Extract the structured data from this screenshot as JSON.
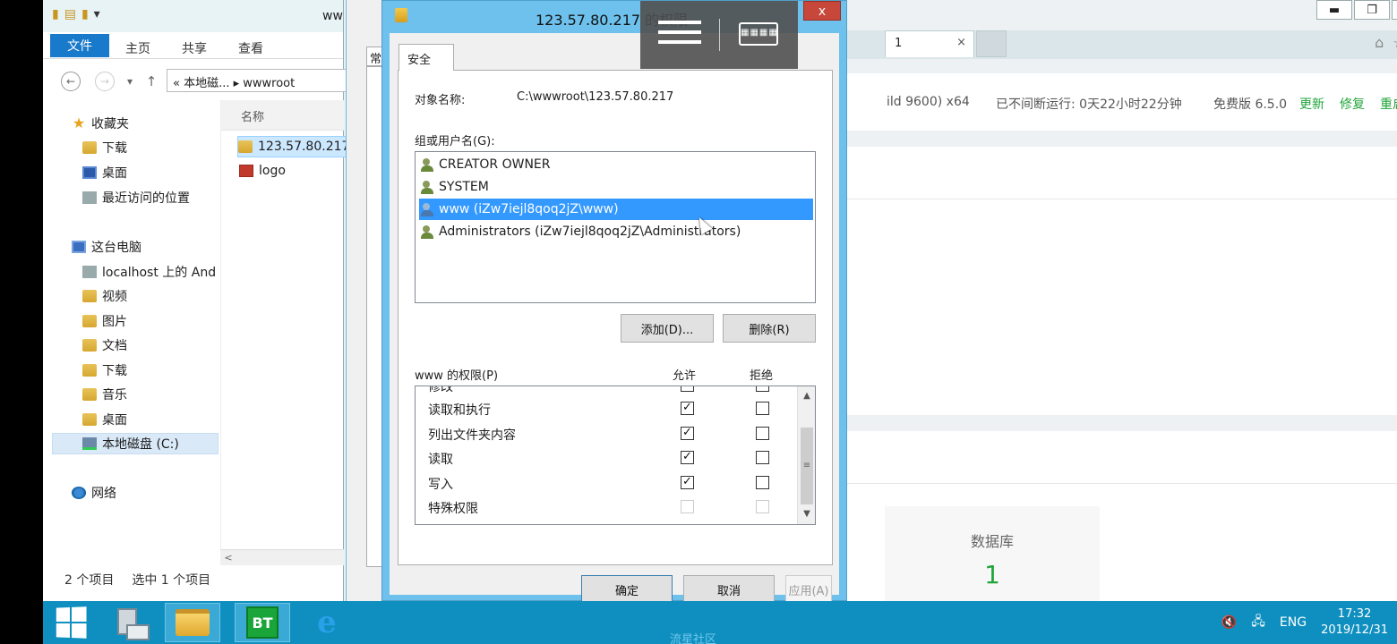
{
  "explorer": {
    "title": "ww",
    "ribbon_tabs": [
      "文件",
      "主页",
      "共享",
      "查看"
    ],
    "address": "«  本地磁... ▸ wwwroot",
    "nav": {
      "favorites": "收藏夹",
      "downloads": "下载",
      "desktop": "桌面",
      "recent": "最近访问的位置",
      "this_pc": "这台电脑",
      "localhost": "localhost 上的 And",
      "videos": "视频",
      "pictures": "图片",
      "documents": "文档",
      "downloads2": "下载",
      "music": "音乐",
      "desktop2": "桌面",
      "local_disk": "本地磁盘 (C:)",
      "network": "网络"
    },
    "column_name": "名称",
    "files": [
      "123.57.80.217",
      "logo"
    ],
    "status_count": "2 个项目",
    "status_selected": "选中 1 个项目"
  },
  "props_dialog": {
    "tab_fragment": "常"
  },
  "perm_dialog": {
    "title": "123.57.80.217 的权限",
    "close": "x",
    "tab": "安全",
    "object_label": "对象名称:",
    "object_value": "C:\\wwwroot\\123.57.80.217",
    "group_label": "组或用户名(G):",
    "users": [
      {
        "name": "CREATOR OWNER",
        "icon": "group-user-icon"
      },
      {
        "name": "SYSTEM",
        "icon": "group-user-icon"
      },
      {
        "name": "www (iZw7iejl8qoq2jZ\\www)",
        "icon": "single-user-icon",
        "selected": true
      },
      {
        "name": "Administrators (iZw7iejl8qoq2jZ\\Administrators)",
        "icon": "group-user-icon"
      }
    ],
    "add_button": "添加(D)...",
    "remove_button": "删除(R)",
    "perm_label": "www 的权限(P)",
    "allow_label": "允许",
    "deny_label": "拒绝",
    "permissions": [
      {
        "name": "修改",
        "allow": true,
        "deny": false
      },
      {
        "name": "读取和执行",
        "allow": true,
        "deny": false
      },
      {
        "name": "列出文件夹内容",
        "allow": true,
        "deny": false
      },
      {
        "name": "读取",
        "allow": true,
        "deny": false
      },
      {
        "name": "写入",
        "allow": true,
        "deny": false
      },
      {
        "name": "特殊权限",
        "allow": false,
        "deny": false,
        "disabled": true
      }
    ],
    "ok_button": "确定",
    "cancel_button": "取消",
    "apply_button": "应用(A)"
  },
  "overlay": {
    "keyboard_icon": "keyboard-icon",
    "menu_icon": "hamburger-menu-icon"
  },
  "browser": {
    "tab_text": "1",
    "tab_close": "×",
    "window_min": "▬",
    "window_restore": "❐",
    "window_close": "✕",
    "os_info": "ild 9600) x64",
    "uptime": "已不间断运行: 0天22小时22分钟",
    "edition": "免费版 6.5.0",
    "update": "更新",
    "repair": "修复",
    "restart": "重启",
    "db_label": "数据库",
    "db_count": "1",
    "accent_color": "#20a53a"
  },
  "taskbar": {
    "lang": "ENG",
    "time": "17:32",
    "date": "2019/12/31",
    "bt_label": "BT",
    "watermark": "流星社区"
  }
}
